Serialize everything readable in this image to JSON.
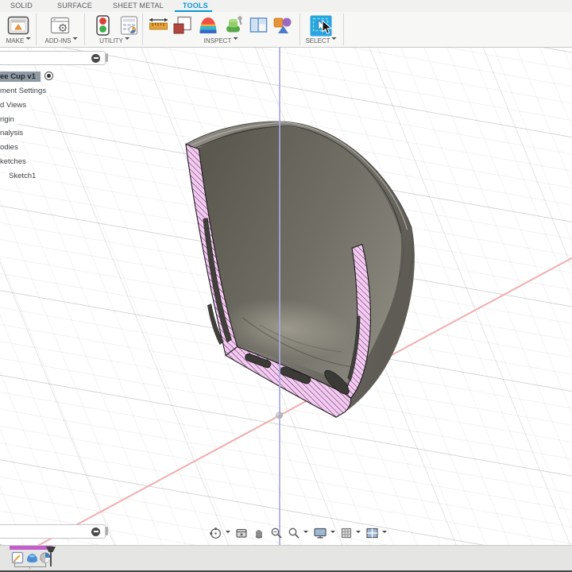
{
  "ribbon": {
    "tabs": [
      {
        "label": "SOLID"
      },
      {
        "label": "SURFACE"
      },
      {
        "label": "SHEET METAL"
      },
      {
        "label": "TOOLS",
        "active": true
      }
    ],
    "active_tab_color": "#0696d7",
    "groups": [
      {
        "label": "MAKE"
      },
      {
        "label": "ADD-INS"
      },
      {
        "label": "UTILITY"
      },
      {
        "label": "INSPECT"
      },
      {
        "label": "SELECT"
      }
    ]
  },
  "browser": {
    "items": [
      {
        "label": "ee Cup v1",
        "selected": true,
        "activate_radio": true
      },
      {
        "label": "ment Settings"
      },
      {
        "label": "d Views"
      },
      {
        "label": "rigin"
      },
      {
        "label": "nalysis"
      },
      {
        "label": "odies"
      },
      {
        "label": "ketches"
      },
      {
        "label": "Sketch1",
        "indented": true
      }
    ]
  },
  "nav_bar": {
    "icons": [
      "orbit",
      "look-at",
      "pan",
      "zoom",
      "fit",
      "display-settings",
      "grid-settings",
      "viewports"
    ]
  },
  "timeline": {
    "features": [
      "sketch",
      "revolve",
      "section-analysis"
    ],
    "group_bar_color": "#c45ec9"
  },
  "canvas": {
    "vertical_axis_color": "#a6aade",
    "red_axis_color": "#f0aeae",
    "section_hatch_fill": "#f6c9f4",
    "section_hatch_line": "#222222",
    "cup_body_color": "#83807a",
    "select_tool_color": "#2aa3e2"
  }
}
